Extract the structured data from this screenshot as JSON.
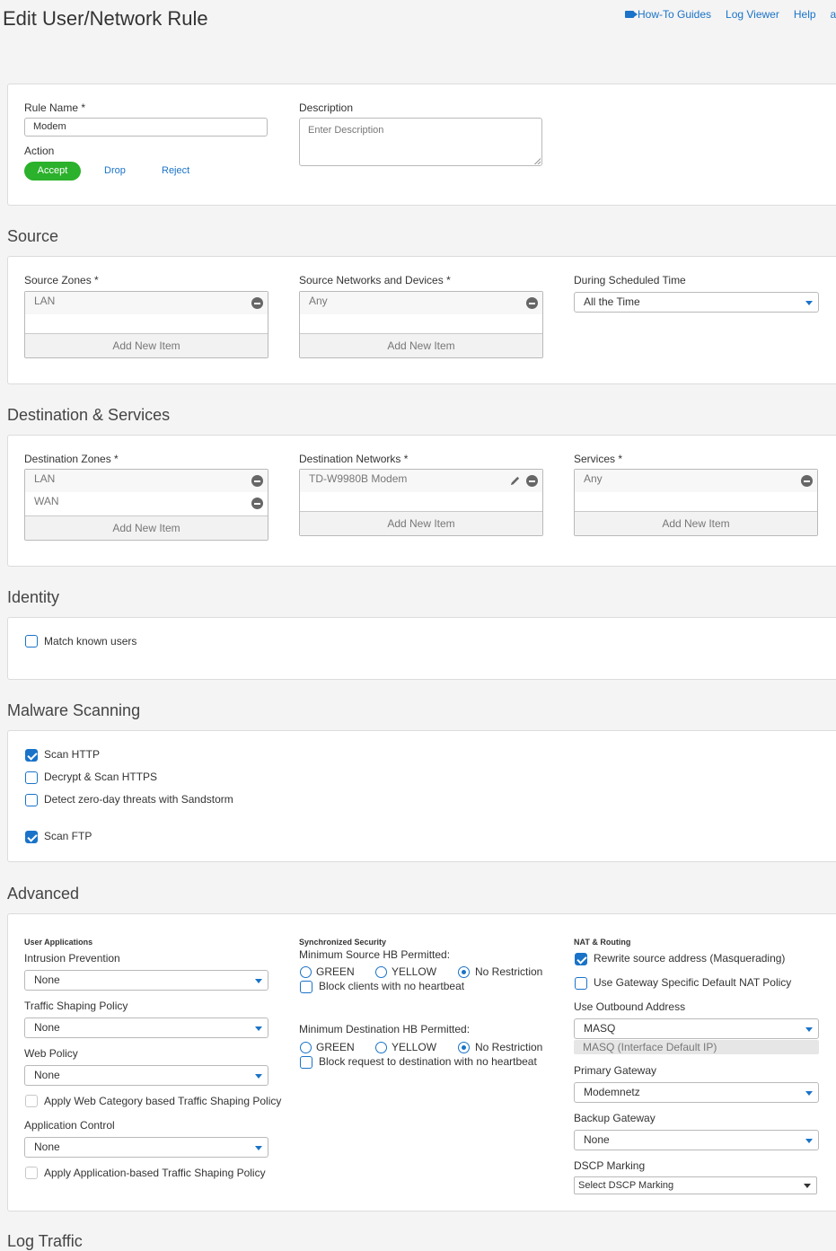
{
  "header": {
    "title": "Edit User/Network Rule",
    "links": {
      "howto": "How-To Guides",
      "logviewer": "Log Viewer",
      "help": "Help",
      "admin": "admin"
    }
  },
  "rule": {
    "name_label": "Rule Name *",
    "name_value": "Modem",
    "description_label": "Description",
    "description_placeholder": "Enter Description",
    "action_label": "Action",
    "actions": [
      "Accept",
      "Drop",
      "Reject"
    ],
    "selected_action": "Accept"
  },
  "source": {
    "title": "Source",
    "zones_label": "Source Zones *",
    "zones": [
      "LAN"
    ],
    "networks_label": "Source Networks and Devices *",
    "networks": [
      "Any"
    ],
    "schedule_label": "During Scheduled Time",
    "schedule_value": "All the Time",
    "add_item": "Add New Item"
  },
  "destination": {
    "title": "Destination & Services",
    "zones_label": "Destination Zones *",
    "zones": [
      "LAN",
      "WAN"
    ],
    "networks_label": "Destination Networks *",
    "networks": [
      "TD-W9980B Modem"
    ],
    "services_label": "Services *",
    "services": [
      "Any"
    ],
    "add_item": "Add New Item"
  },
  "identity": {
    "title": "Identity",
    "match_known_users": "Match known users",
    "match_known_users_checked": false
  },
  "malware": {
    "title": "Malware Scanning",
    "scan_http": "Scan HTTP",
    "scan_http_checked": true,
    "decrypt_https": "Decrypt & Scan HTTPS",
    "decrypt_https_checked": false,
    "sandstorm": "Detect zero-day threats with Sandstorm",
    "sandstorm_checked": false,
    "scan_ftp": "Scan FTP",
    "scan_ftp_checked": true
  },
  "advanced": {
    "title": "Advanced",
    "user_apps": {
      "heading": "User Applications",
      "ips_label": "Intrusion Prevention",
      "ips_value": "None",
      "traffic_shaping_label": "Traffic Shaping Policy",
      "traffic_shaping_value": "None",
      "web_policy_label": "Web Policy",
      "web_policy_value": "None",
      "web_category_shaping": "Apply Web Category based Traffic Shaping Policy",
      "app_control_label": "Application Control",
      "app_control_value": "None",
      "app_shaping": "Apply Application-based Traffic Shaping Policy"
    },
    "sync_security": {
      "heading": "Synchronized Security",
      "min_source_label": "Minimum Source HB Permitted:",
      "min_dest_label": "Minimum Destination HB Permitted:",
      "options": [
        "GREEN",
        "YELLOW",
        "No Restriction"
      ],
      "selected_source": "No Restriction",
      "selected_dest": "No Restriction",
      "block_clients": "Block clients with no heartbeat",
      "block_request": "Block request to destination with no heartbeat"
    },
    "nat": {
      "heading": "NAT & Routing",
      "rewrite_source": "Rewrite source address (Masquerading)",
      "rewrite_source_checked": true,
      "gateway_nat": "Use Gateway Specific Default NAT Policy",
      "gateway_nat_checked": false,
      "outbound_label": "Use Outbound Address",
      "outbound_value": "MASQ",
      "outbound_hint": "MASQ (Interface Default IP)",
      "primary_gw_label": "Primary Gateway",
      "primary_gw_value": "Modemnetz",
      "backup_gw_label": "Backup Gateway",
      "backup_gw_value": "None",
      "dscp_label": "DSCP Marking",
      "dscp_value": "Select DSCP Marking"
    }
  },
  "log_traffic": {
    "title": "Log Traffic"
  },
  "colors": {
    "accent": "#1a73c8",
    "accept": "#2bb12b"
  }
}
